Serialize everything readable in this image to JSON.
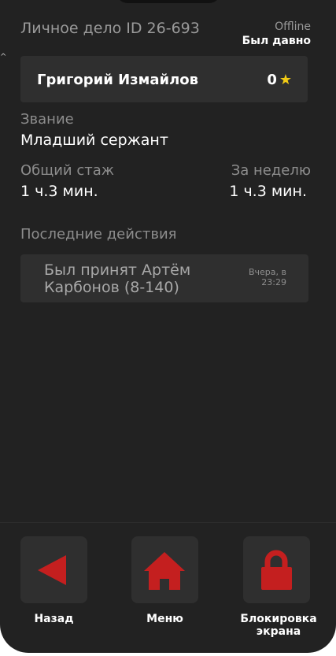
{
  "header": {
    "title": "Личное дело ID 26-693",
    "status": "Offline",
    "last_seen": "Был давно"
  },
  "profile": {
    "name": "Григорий Измайлов",
    "rating": "0",
    "rating_icon": "star-icon",
    "rating_color": "#f2cb15"
  },
  "rank": {
    "label": "Звание",
    "value": "Младший сержант"
  },
  "stats": {
    "total_label": "Общий стаж",
    "total_value": "1 ч.3 мин.",
    "week_label": "За неделю",
    "week_value": "1 ч.3 мин."
  },
  "recent": {
    "label": "Последние действия",
    "items": [
      {
        "text": "Был принят Артём Карбонов (8-140)",
        "time": "Вчера, в 23:29"
      }
    ]
  },
  "nav": {
    "back_label": "Назад",
    "menu_label": "Меню",
    "lock_label": "Блокировка экрана",
    "icon_color": "#c41f1f"
  }
}
